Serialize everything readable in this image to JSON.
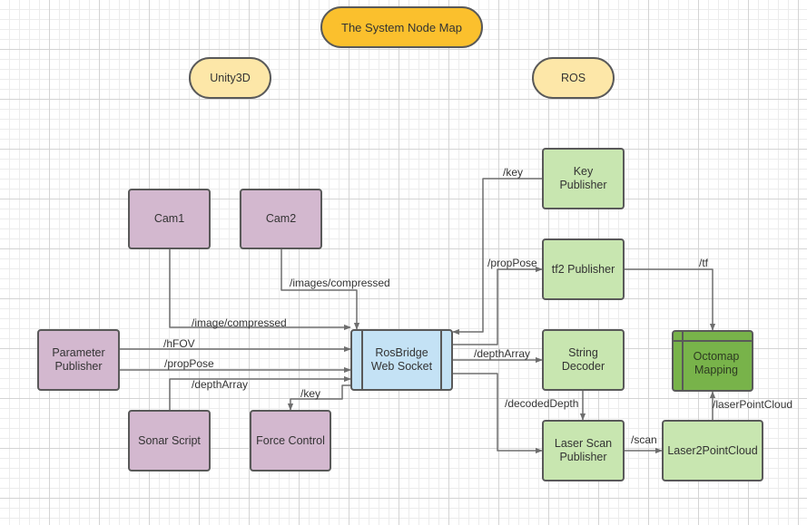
{
  "title": "The System Node Map",
  "sections": {
    "unity": "Unity3D",
    "ros": "ROS"
  },
  "nodes": {
    "cam1": "Cam1",
    "cam2": "Cam2",
    "parameter_publisher": "Parameter Publisher",
    "sonar_script": "Sonar Script",
    "force_control": "Force Control",
    "rosbridge": "RosBridge Web Socket",
    "key_publisher": "Key Publisher",
    "tf2_publisher": "tf2 Publisher",
    "string_decoder": "String Decoder",
    "laser_scan_publisher": "Laser Scan Publisher",
    "laser2pointcloud": "Laser2PointCloud",
    "octomap_mapping": "Octomap Mapping"
  },
  "edges": {
    "cam1_image": "/image/compressed",
    "cam2_images": "/images/compressed",
    "hfov": "/hFOV",
    "proppose_left": "/propPose",
    "deptharray_left": "/depthArray",
    "key_left": "/key",
    "key_right": "/key",
    "proppose_right": "/propPose",
    "deptharray_right": "/depthArray",
    "decoded_depth": "/decodedDepth",
    "tf": "/tf",
    "scan": "/scan",
    "laser_point_cloud": "/laserPointCloud"
  },
  "colors": {
    "title_fill": "#fbc02d",
    "section_fill": "#fde7a8",
    "unity_node_fill": "#d3b8cf",
    "ros_node_fill": "#c8e6b0",
    "bridge_fill": "#c4e2f5",
    "octomap_fill": "#78b34a",
    "edge_stroke": "#6e6e6e"
  }
}
